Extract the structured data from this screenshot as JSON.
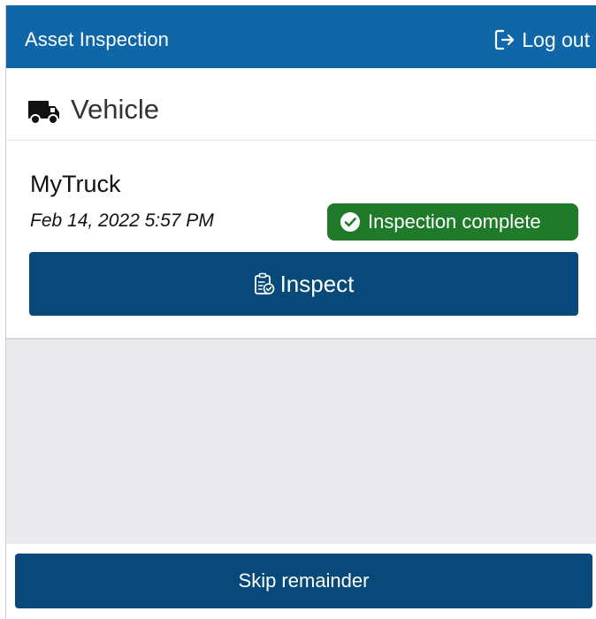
{
  "header": {
    "title": "Asset Inspection",
    "logout_label": "Log out",
    "logout_icon": "sign-out-icon",
    "background": "#0f66a8"
  },
  "section": {
    "title": "Vehicle",
    "icon": "truck-icon"
  },
  "asset": {
    "name": "MyTruck",
    "timestamp": "Feb 14, 2022 5:57 PM",
    "status": {
      "label": "Inspection complete",
      "icon": "check-circle-icon",
      "color": "#1f7a2a"
    },
    "inspect_button": {
      "label": "Inspect",
      "icon": "clipboard-check-icon"
    }
  },
  "footer": {
    "skip_label": "Skip remainder"
  },
  "colors": {
    "button": "#074a79",
    "page_background": "#e9ebee"
  }
}
